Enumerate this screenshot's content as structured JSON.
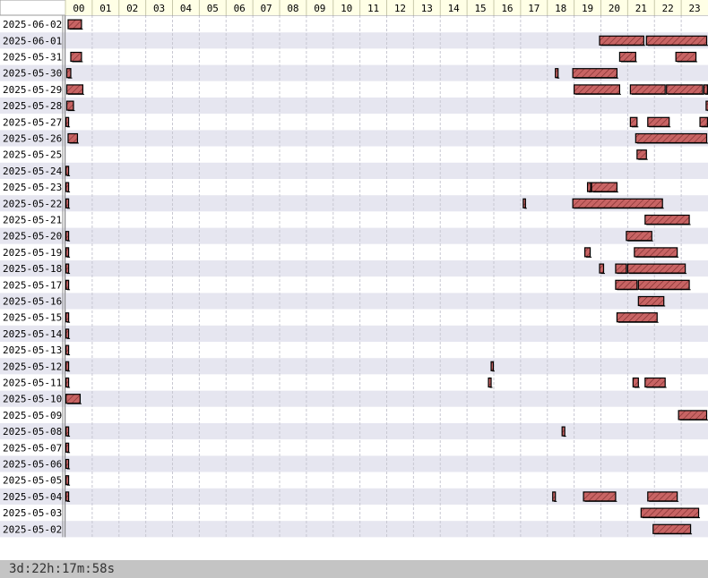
{
  "chart_data": {
    "type": "timeline",
    "x_unit": "hour of day",
    "xlim": [
      0,
      24
    ],
    "hour_labels": [
      "00",
      "01",
      "02",
      "03",
      "04",
      "05",
      "06",
      "07",
      "08",
      "09",
      "10",
      "11",
      "12",
      "13",
      "14",
      "15",
      "16",
      "17",
      "18",
      "19",
      "20",
      "21",
      "22",
      "23"
    ],
    "dates": [
      "2025-06-02",
      "2025-06-01",
      "2025-05-31",
      "2025-05-30",
      "2025-05-29",
      "2025-05-28",
      "2025-05-27",
      "2025-05-26",
      "2025-05-25",
      "2025-05-24",
      "2025-05-23",
      "2025-05-22",
      "2025-05-21",
      "2025-05-20",
      "2025-05-19",
      "2025-05-18",
      "2025-05-17",
      "2025-05-16",
      "2025-05-15",
      "2025-05-14",
      "2025-05-13",
      "2025-05-12",
      "2025-05-11",
      "2025-05-10",
      "2025-05-09",
      "2025-05-08",
      "2025-05-07",
      "2025-05-06",
      "2025-05-05",
      "2025-05-04",
      "2025-05-03",
      "2025-05-02"
    ],
    "sessions": [
      [
        [
          0.1,
          0.6
        ]
      ],
      [
        [
          19.95,
          21.6
        ],
        [
          21.7,
          23.95
        ]
      ],
      [
        [
          0.2,
          0.6
        ],
        [
          20.7,
          21.3
        ],
        [
          22.8,
          23.55
        ]
      ],
      [
        [
          0.05,
          0.2
        ],
        [
          18.3,
          18.4
        ],
        [
          18.95,
          20.6
        ]
      ],
      [
        [
          0.05,
          0.65
        ],
        [
          19.0,
          20.7
        ],
        [
          21.1,
          22.4
        ],
        [
          22.45,
          23.8
        ],
        [
          23.85,
          23.98
        ]
      ],
      [
        [
          0.05,
          0.3
        ],
        [
          23.93,
          23.99
        ]
      ],
      [
        [
          0.02,
          0.12
        ],
        [
          21.1,
          21.35
        ],
        [
          21.75,
          22.55
        ],
        [
          23.7,
          23.98
        ]
      ],
      [
        [
          0.1,
          0.45
        ],
        [
          21.3,
          23.95
        ]
      ],
      [
        [
          21.35,
          21.7
        ]
      ],
      [
        [
          0.02,
          0.12
        ]
      ],
      [
        [
          0.02,
          0.12
        ],
        [
          19.5,
          19.62
        ],
        [
          19.65,
          20.6
        ]
      ],
      [
        [
          0.02,
          0.12
        ],
        [
          17.1,
          17.18
        ],
        [
          18.95,
          22.3
        ]
      ],
      [
        [
          21.65,
          23.3
        ]
      ],
      [
        [
          0.02,
          0.12
        ],
        [
          20.95,
          21.9
        ]
      ],
      [
        [
          0.02,
          0.12
        ],
        [
          19.4,
          19.6
        ],
        [
          21.25,
          22.85
        ]
      ],
      [
        [
          0.02,
          0.12
        ],
        [
          19.95,
          20.1
        ],
        [
          20.55,
          20.95
        ],
        [
          21.0,
          23.15
        ]
      ],
      [
        [
          0.02,
          0.12
        ],
        [
          20.55,
          21.35
        ],
        [
          21.4,
          23.3
        ]
      ],
      [
        [
          21.4,
          22.35
        ]
      ],
      [
        [
          0.02,
          0.12
        ],
        [
          20.6,
          22.1
        ]
      ],
      [
        [
          0.02,
          0.12
        ]
      ],
      [
        [
          0.02,
          0.12
        ]
      ],
      [
        [
          0.02,
          0.12
        ],
        [
          15.9,
          15.98
        ]
      ],
      [
        [
          0.02,
          0.12
        ],
        [
          15.8,
          15.9
        ],
        [
          21.2,
          21.4
        ],
        [
          21.65,
          22.4
        ]
      ],
      [
        [
          0.02,
          0.55
        ]
      ],
      [
        [
          22.9,
          23.95
        ]
      ],
      [
        [
          0.02,
          0.12
        ],
        [
          18.55,
          18.65
        ]
      ],
      [
        [
          0.02,
          0.12
        ]
      ],
      [
        [
          0.02,
          0.12
        ]
      ],
      [
        [
          0.02,
          0.12
        ]
      ],
      [
        [
          0.02,
          0.12
        ],
        [
          18.2,
          18.3
        ],
        [
          19.35,
          20.55
        ],
        [
          21.75,
          22.85
        ]
      ],
      [
        [
          21.5,
          23.65
        ]
      ],
      [
        [
          21.95,
          23.35
        ]
      ]
    ],
    "bar_color": "#c86464",
    "bar_hatch_color": "#ffffff",
    "bar_border_color": "#000000",
    "row_colors": [
      "#ffffff",
      "#e6e6f0"
    ],
    "header_color": "#ffffe6",
    "grid": true
  },
  "footer": {
    "total": "3d:22h:17m:58s"
  }
}
